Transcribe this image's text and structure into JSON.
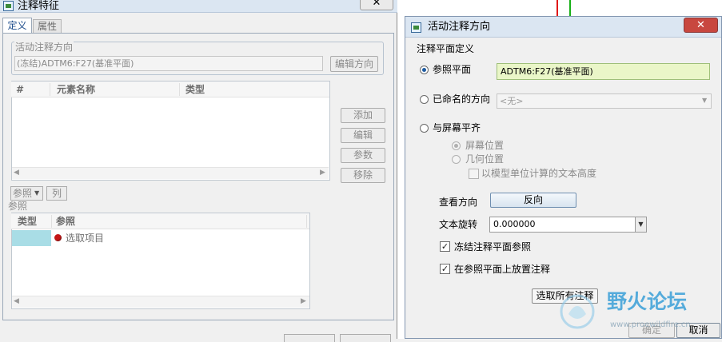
{
  "left_window": {
    "title": "注释特征",
    "close": "✕",
    "tabs": [
      {
        "label": "定义"
      },
      {
        "label": "属性"
      }
    ],
    "active_direction": {
      "group_label": "活动注释方向",
      "value": "(冻结)ADTM6:F27(基准平面)",
      "edit_button": "编辑方向"
    },
    "elements_table": {
      "columns": [
        "#",
        "元素名称",
        "类型"
      ],
      "rows": []
    },
    "side_buttons": [
      "添加",
      "编辑",
      "参数",
      "移除"
    ],
    "references_dropdown": "参照",
    "columns_button": "列",
    "references_label": "参照",
    "references_table": {
      "columns": [
        "类型",
        "参照"
      ],
      "rows": [
        {
          "type": "",
          "ref": "选取项目"
        }
      ]
    }
  },
  "right_window": {
    "title": "活动注释方向",
    "close": "✕",
    "section_title": "注释平面定义",
    "options": {
      "ref_plane": {
        "label": "参照平面",
        "value": "ADTM6:F27(基准平面)",
        "selected": true
      },
      "named_dir": {
        "label": "已命名的方向",
        "value": "<无>",
        "selected": false
      },
      "screen_align": {
        "label": "与屏幕平齐",
        "selected": false
      }
    },
    "screen_suboptions": {
      "screen_pos": {
        "label": "屏幕位置",
        "selected": true
      },
      "geom_pos": {
        "label": "几何位置",
        "selected": false
      },
      "model_units": {
        "label": "以模型单位计算的文本高度",
        "checked": false
      }
    },
    "view_direction": {
      "label": "查看方向",
      "button": "反向"
    },
    "text_rotation": {
      "label": "文本旋转",
      "value": "0.000000"
    },
    "checkboxes": {
      "freeze": {
        "label": "冻结注释平面参照",
        "checked": true
      },
      "place": {
        "label": "在参照平面上放置注释",
        "checked": true
      }
    },
    "select_all_button": "选取所有注释",
    "ok_button": "确定",
    "cancel_button": "取消"
  },
  "watermark": {
    "text": "野火论坛",
    "url": "www.proewildfire.cn"
  },
  "colors": {
    "titlebar": "#dbe6f2",
    "close_active": "#c8473f",
    "ref_field": "#eaf6c8",
    "row_highlight": "#a9dde6",
    "bullet": "#c41616",
    "watermark": "#3aa0d8"
  }
}
